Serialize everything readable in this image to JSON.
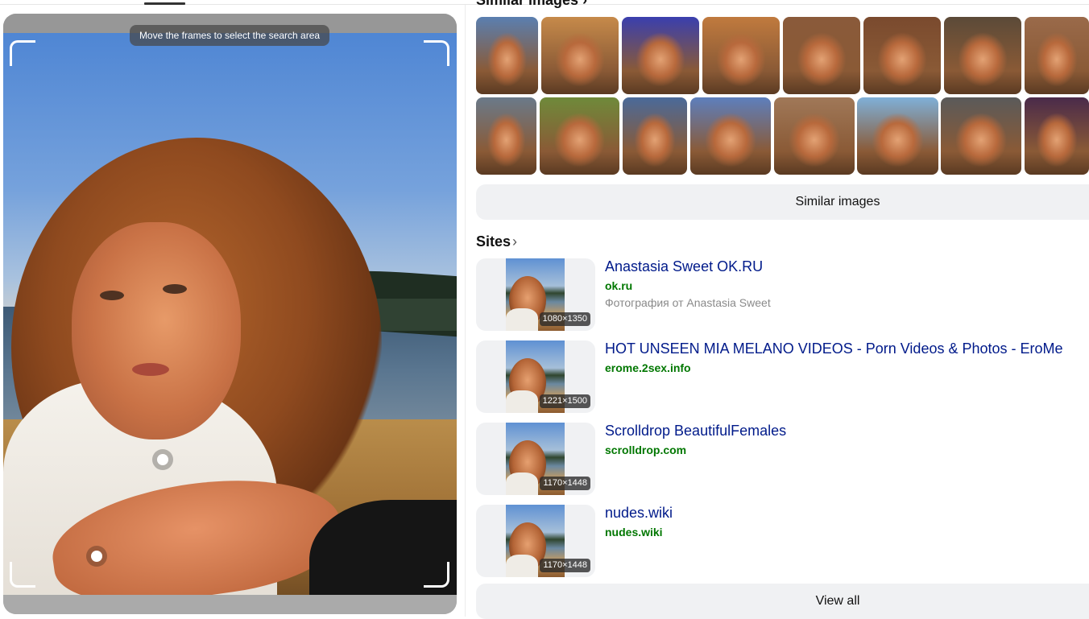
{
  "crop": {
    "hint": "Move the frames to select the search area"
  },
  "similar": {
    "heading": "Similar images",
    "button_label": "Similar images",
    "row1_colors": [
      "#5a7fb0",
      "#c68a4a",
      "#3a3fae",
      "#c07a3e",
      "#8a5a3a",
      "#7a4a2e",
      "#5b4a38",
      "#9a6a4a"
    ],
    "row2_colors": [
      "#6a7a8a",
      "#6f8a3a",
      "#4a6a9a",
      "#5d7fbd",
      "#a07858",
      "#7fb0d8",
      "#5a5a5a",
      "#4a2a4a"
    ]
  },
  "sites": {
    "heading": "Sites",
    "items": [
      {
        "title": "Anastasia Sweet OK.RU",
        "domain": "ok.ru",
        "description": "Фотография от Anastasia Sweet",
        "size": "1080×1350"
      },
      {
        "title": "HOT UNSEEN MIA MELANO VIDEOS - Porn Videos & Photos - EroMe",
        "domain": "erome.2sex.info",
        "description": "",
        "size": "1221×1500"
      },
      {
        "title": "Scrolldrop BeautifulFemales",
        "domain": "scrolldrop.com",
        "description": "",
        "size": "1170×1448"
      },
      {
        "title": "nudes.wiki",
        "domain": "nudes.wiki",
        "description": "",
        "size": "1170×1448"
      }
    ],
    "view_all_label": "View all"
  }
}
